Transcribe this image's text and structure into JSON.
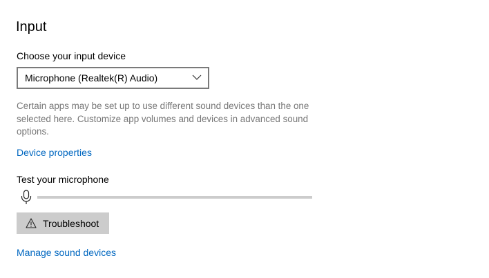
{
  "section": {
    "title": "Input"
  },
  "input_device": {
    "label": "Choose your input device",
    "selected": "Microphone (Realtek(R) Audio)",
    "note": "Certain apps may be set up to use different sound devices than the one selected here. Customize app volumes and devices in advanced sound options."
  },
  "links": {
    "device_properties": "Device properties",
    "manage_sound_devices": "Manage sound devices"
  },
  "test": {
    "label": "Test your microphone",
    "level_percent": 0
  },
  "troubleshoot": {
    "label": "Troubleshoot"
  },
  "icons": {
    "dropdown": "chevron-down-icon",
    "microphone": "microphone-icon",
    "warning": "warning-icon"
  },
  "colors": {
    "link": "#0067c0",
    "note_text": "#767676",
    "button_bg": "#cccccc",
    "level_track": "#cccccc"
  }
}
